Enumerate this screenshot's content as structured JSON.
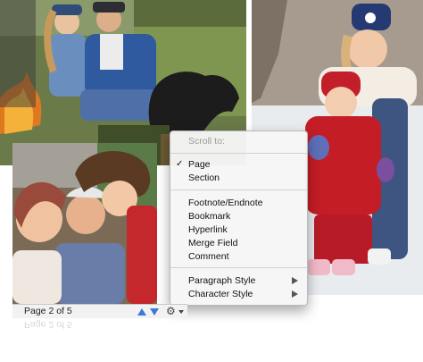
{
  "menu": {
    "header": "Scroll to:",
    "check_mark": "✓",
    "group1": [
      {
        "label": "Page",
        "checked": true
      },
      {
        "label": "Section",
        "checked": false
      }
    ],
    "group2": [
      {
        "label": "Footnote/Endnote"
      },
      {
        "label": "Bookmark"
      },
      {
        "label": "Hyperlink"
      },
      {
        "label": "Merge Field"
      },
      {
        "label": "Comment"
      }
    ],
    "group3": [
      {
        "label": "Paragraph Style",
        "submenu": true
      },
      {
        "label": "Character Style",
        "submenu": true
      }
    ]
  },
  "statusbar": {
    "page_label": "Page 2 of 5",
    "up_icon": "up-arrow-icon",
    "down_icon": "down-arrow-icon",
    "gear_icon": "gear-icon",
    "arrow_color": "#3e78d8"
  },
  "photos": {
    "top_left": "campfire-family-photo",
    "top_right": "snow-mother-child-photo",
    "bottom_left": "grandparents-child-photo"
  }
}
